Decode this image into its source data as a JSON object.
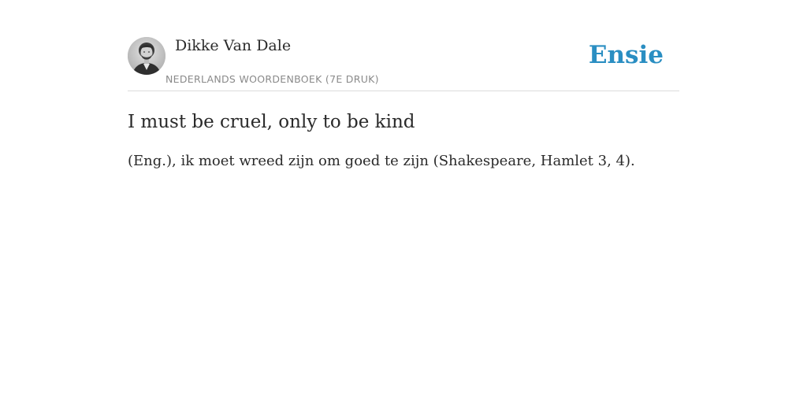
{
  "header": {
    "author_name": "Dikke Van Dale",
    "source": "Nederlands woordenboek (7e druk)",
    "brand": "Ensie",
    "brand_color": "#2a8ec2"
  },
  "entry": {
    "term": "I must be cruel, only to be kind",
    "definition": "(Eng.), ik moet wreed zijn om goed te zijn (Shakespeare, Hamlet 3, 4)."
  }
}
